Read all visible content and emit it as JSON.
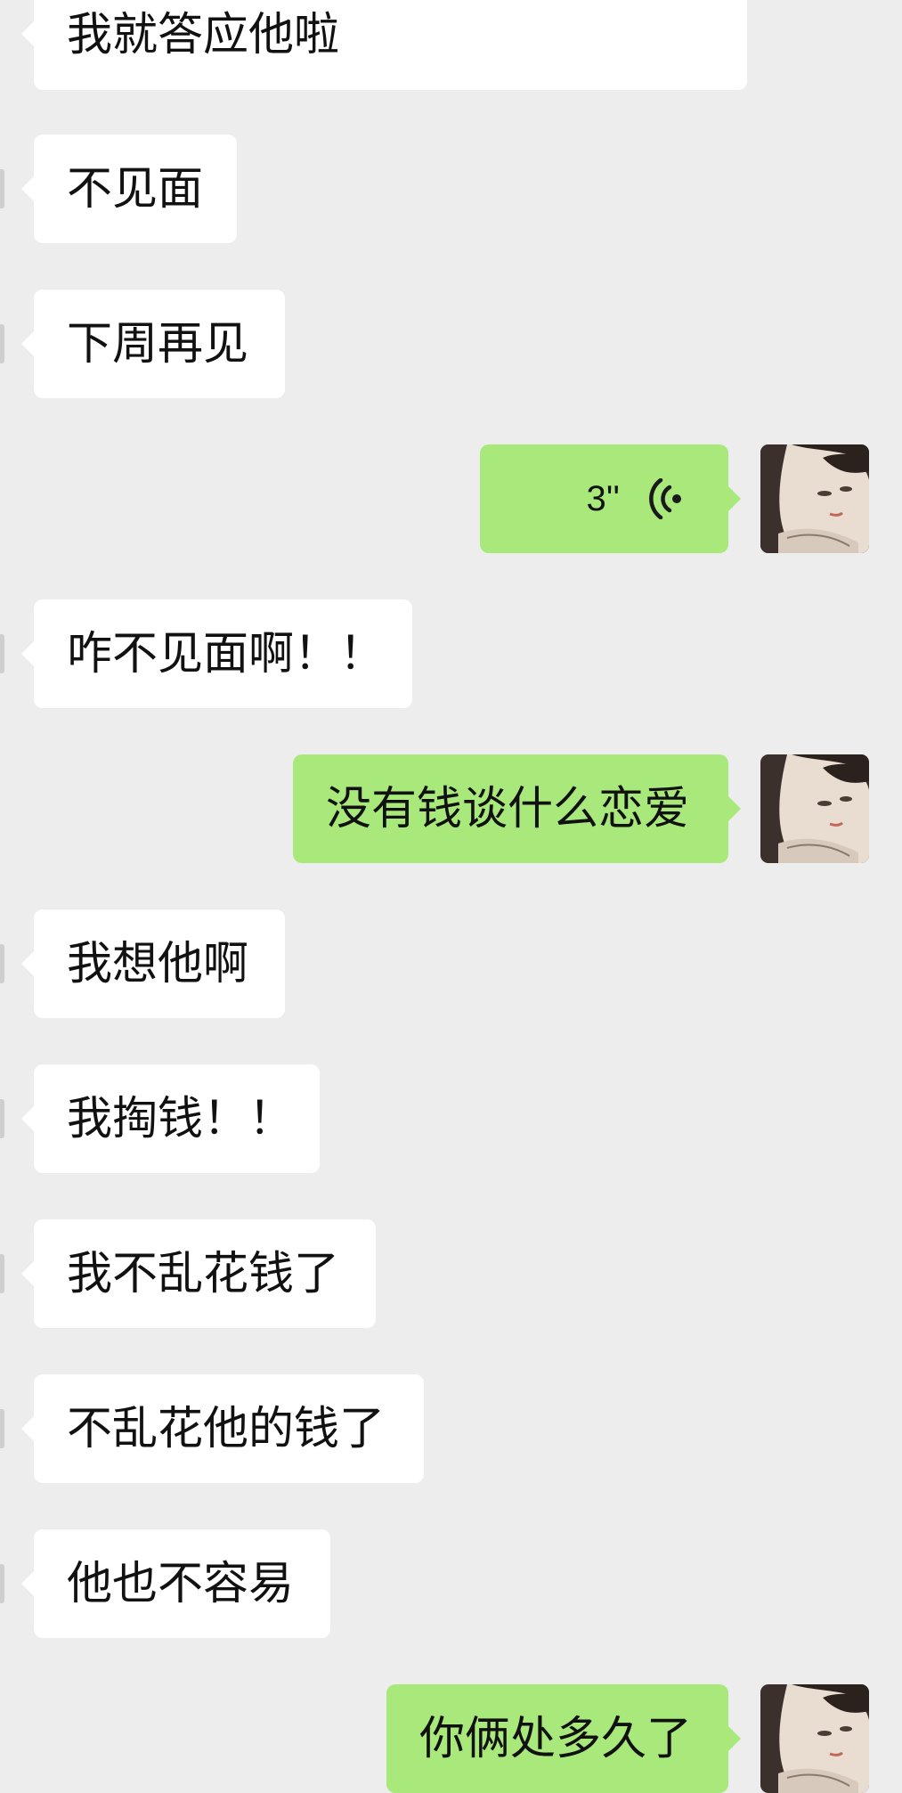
{
  "chat": {
    "messages": [
      {
        "side": "in",
        "text": "我就答应他啦"
      },
      {
        "side": "in",
        "text": "不见面"
      },
      {
        "side": "in",
        "text": "下周再见"
      },
      {
        "side": "out",
        "type": "voice",
        "duration": "3''"
      },
      {
        "side": "in",
        "text": "咋不见面啊！！"
      },
      {
        "side": "out",
        "text": "没有钱谈什么恋爱"
      },
      {
        "side": "in",
        "text": "我想他啊"
      },
      {
        "side": "in",
        "text": "我掏钱！！"
      },
      {
        "side": "in",
        "text": "我不乱花钱了"
      },
      {
        "side": "in",
        "text": "不乱花他的钱了"
      },
      {
        "side": "in",
        "text": "他也不容易"
      },
      {
        "side": "out",
        "text": "你俩处多久了"
      }
    ]
  },
  "colors": {
    "background": "#ededed",
    "incoming_bubble": "#ffffff",
    "outgoing_bubble": "#a9e97b",
    "text": "#111111"
  },
  "icons": {
    "avatar": "illustrated-girl-avatar",
    "voice": "voice-wave-icon"
  }
}
